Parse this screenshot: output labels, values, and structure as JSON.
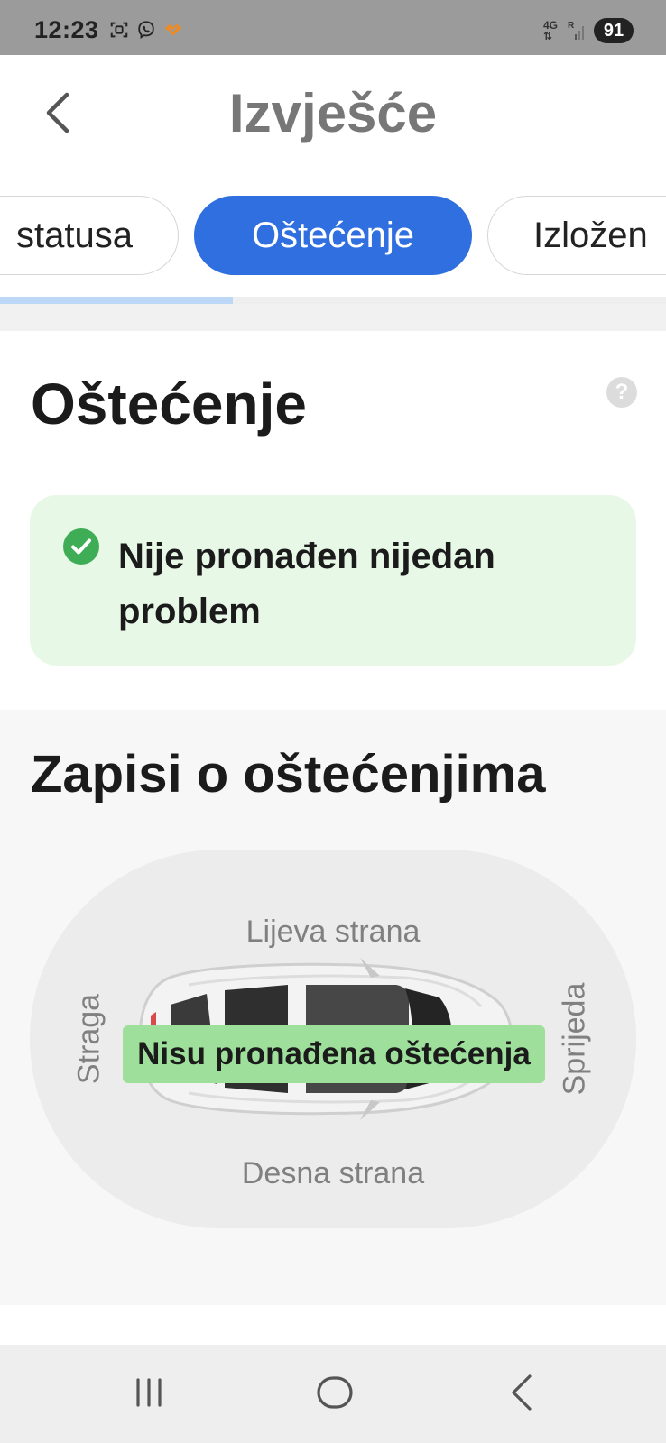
{
  "status_bar": {
    "time": "12:23",
    "network": "4G",
    "signal_label": "R",
    "battery": "91"
  },
  "header": {
    "title": "Izvješće"
  },
  "tabs": [
    {
      "label": "Izvješće o stanju statusa",
      "visible_text": "statusa",
      "active": false
    },
    {
      "label": "Oštećenje",
      "visible_text": "Oštećenje",
      "active": true
    },
    {
      "label": "Izloženost",
      "visible_text": "Izložen",
      "active": false
    }
  ],
  "tabs_scroll_progress": 0.35,
  "damage": {
    "title": "Oštećenje",
    "help": "?",
    "result": "Nije pronađen nijedan problem",
    "result_color": "#e7f8e7",
    "check_color": "#3fad55"
  },
  "records": {
    "title": "Zapisi o oštećenjima",
    "left_side": "Lijeva strana",
    "right_side": "Desna strana",
    "rear": "Straga",
    "front": "Sprijeda",
    "badge": "Nisu pronađena oštećenja",
    "badge_color": "#9ee09b"
  },
  "nav": {
    "recents": "recents-icon",
    "home": "home-icon",
    "back": "back-icon"
  },
  "accent_color": "#2f6fdf"
}
